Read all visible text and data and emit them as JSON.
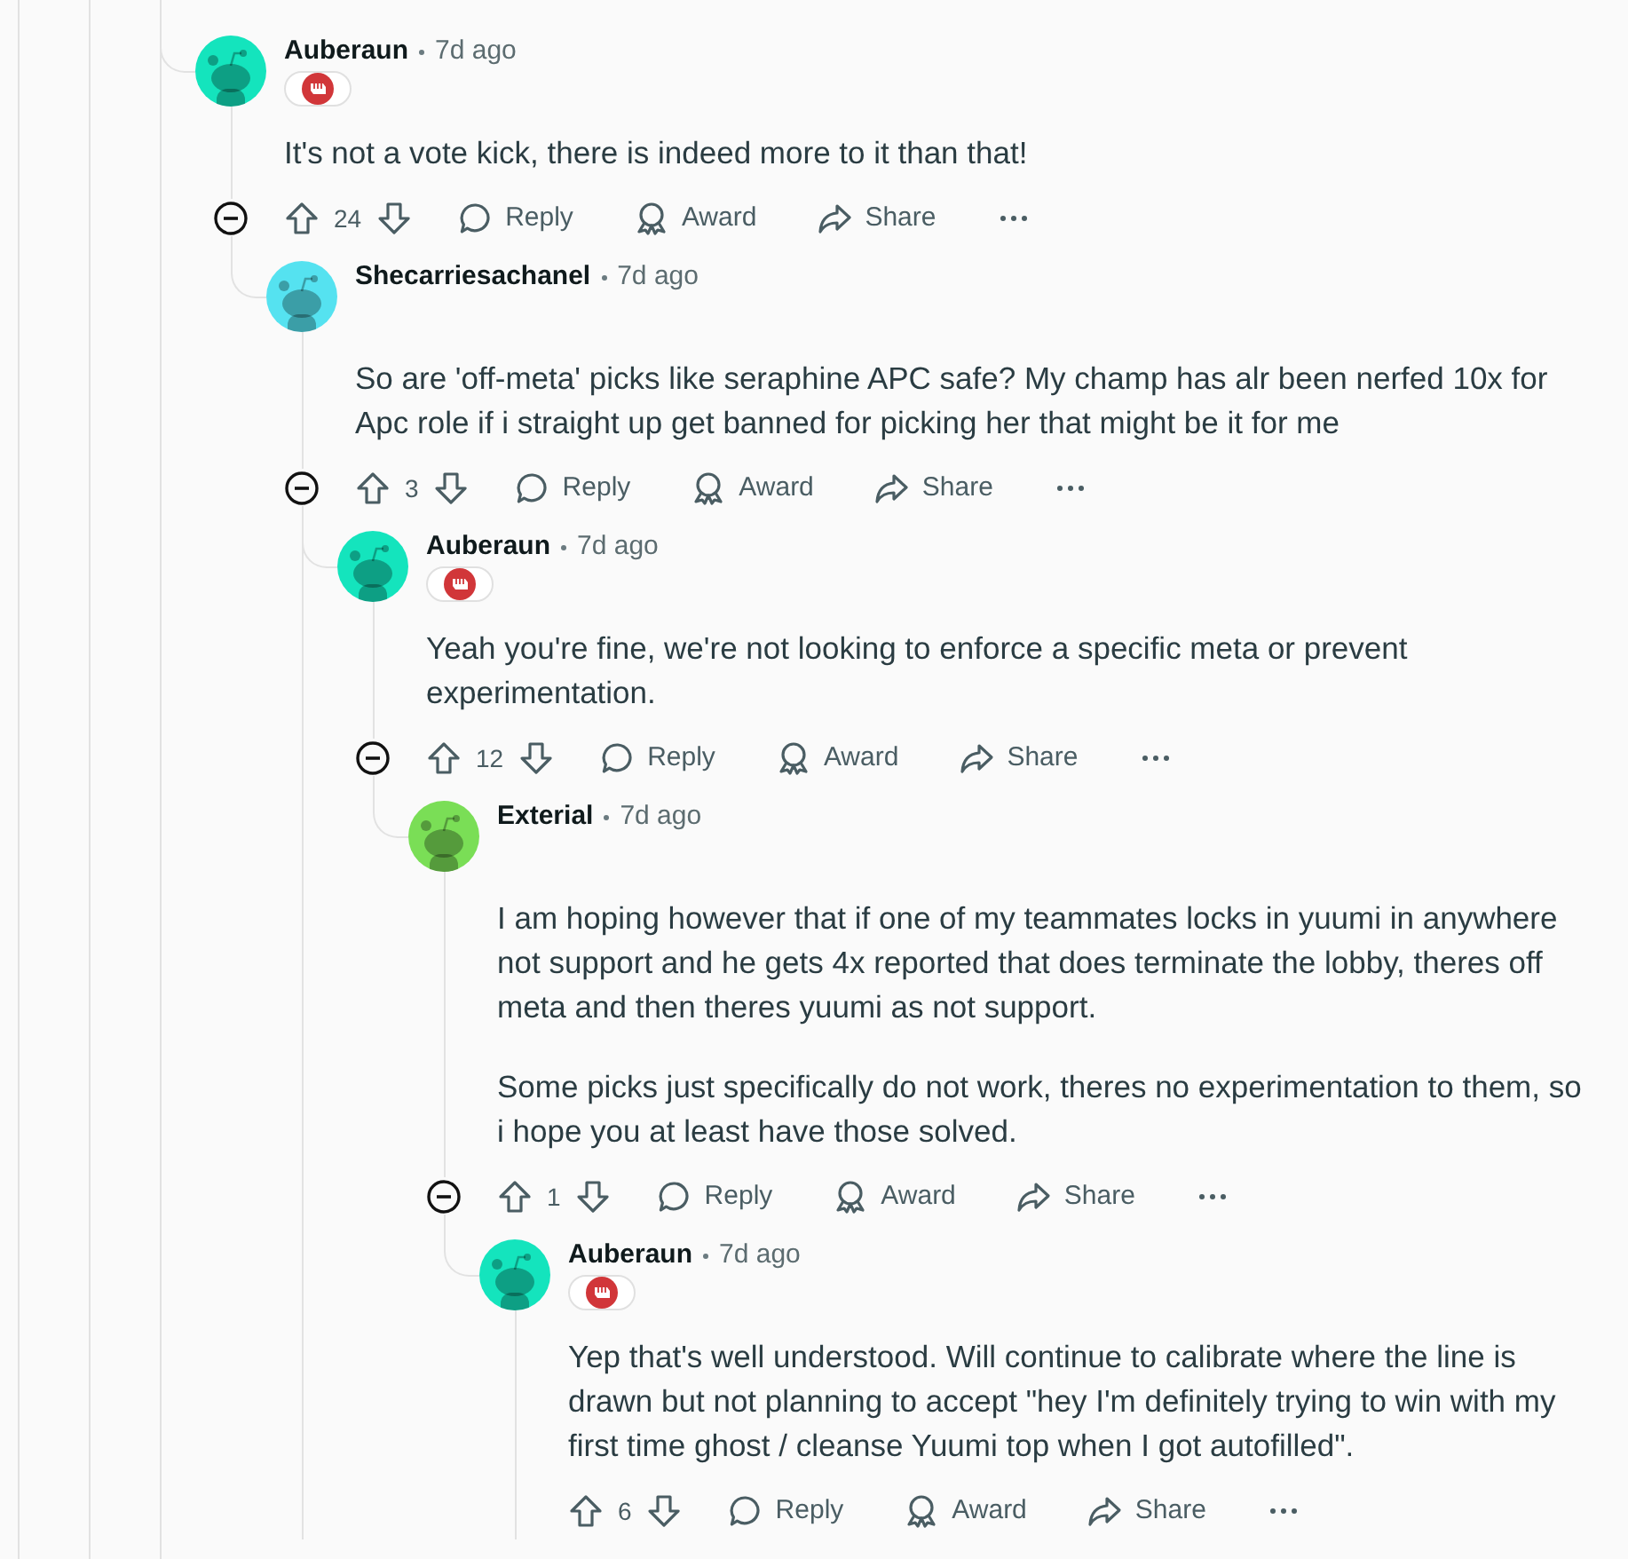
{
  "comments": [
    {
      "author": "Auberaun",
      "time": "7d ago",
      "color": "#14e4bd",
      "flair": true,
      "body": [
        "It's not a vote kick, there is indeed more to it than that!"
      ],
      "votes": "24",
      "more_replies_below": false,
      "actions": [
        {
          "kind": "reply",
          "label": "Reply"
        },
        {
          "kind": "award",
          "label": "Award"
        },
        {
          "kind": "share",
          "label": "Share"
        },
        {
          "kind": "more"
        }
      ],
      "replies": [
        {
          "author": "Shecarriesachanel",
          "time": "7d ago",
          "color": "#55e2f0",
          "flair": false,
          "body": [
            "So are 'off-meta' picks like seraphine APC safe? My champ has alr been nerfed 10x for Apc role if i straight up get banned for picking her that might be it for me"
          ],
          "votes": "3",
          "more_replies_below": true,
          "actions": [
            {
              "kind": "reply",
              "label": "Reply"
            },
            {
              "kind": "award",
              "label": "Award"
            },
            {
              "kind": "share",
              "label": "Share"
            },
            {
              "kind": "more"
            }
          ],
          "replies": [
            {
              "author": "Auberaun",
              "time": "7d ago",
              "color": "#14e4bd",
              "flair": true,
              "body": [
                "Yeah you're fine, we're not looking to enforce a specific meta or prevent experimentation."
              ],
              "votes": "12",
              "more_replies_below": false,
              "actions": [
                {
                  "kind": "reply",
                  "label": "Reply"
                },
                {
                  "kind": "award",
                  "label": "Award"
                },
                {
                  "kind": "share",
                  "label": "Share"
                },
                {
                  "kind": "more"
                }
              ],
              "replies": [
                {
                  "author": "Exterial",
                  "time": "7d ago",
                  "color": "#7ade56",
                  "flair": false,
                  "body": [
                    "I am hoping however that if one of my teammates locks in yuumi in anywhere not support and he gets 4x reported that does terminate the lobby, theres off meta and then theres yuumi as not support.",
                    "Some picks just specifically do not work, theres no experimentation to them, so i hope you at least have those solved."
                  ],
                  "votes": "1",
                  "more_replies_below": false,
                  "actions": [
                    {
                      "kind": "reply",
                      "label": "Reply"
                    },
                    {
                      "kind": "award",
                      "label": "Award"
                    },
                    {
                      "kind": "share",
                      "label": "Share"
                    },
                    {
                      "kind": "more"
                    }
                  ],
                  "replies": [
                    {
                      "author": "Auberaun",
                      "time": "7d ago",
                      "color": "#14e4bd",
                      "flair": true,
                      "body": [
                        "Yep that's well understood. Will continue to calibrate where the line is drawn but not planning to accept \"hey I'm definitely trying to win with my first time ghost / cleanse Yuumi top when I got autofilled\"."
                      ],
                      "votes": "6",
                      "more_replies_below": false,
                      "actions": [
                        {
                          "kind": "reply",
                          "label": "Reply"
                        },
                        {
                          "kind": "award",
                          "label": "Award"
                        },
                        {
                          "kind": "share",
                          "label": "Share"
                        },
                        {
                          "kind": "more"
                        }
                      ]
                    }
                  ]
                }
              ]
            }
          ]
        }
      ]
    }
  ]
}
